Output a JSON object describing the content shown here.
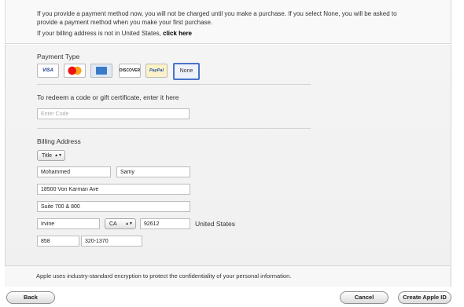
{
  "intro": {
    "line1": "If you provide a payment method now, you will not be charged until you make a purchase. If you select None, you will be asked to",
    "line2": "provide a payment method when you make your first purchase.",
    "line3_prefix": "If your billing address is not in United States, ",
    "line3_link": "click here"
  },
  "payment": {
    "title": "Payment Type",
    "cards": {
      "visa": "VISA",
      "discover": "DISCOVER",
      "paypal": "PayPal"
    },
    "none_label": "None"
  },
  "gift": {
    "title": "To redeem a code or gift certificate, enter it here",
    "placeholder": "Enter Code"
  },
  "billing": {
    "title": "Billing Address",
    "title_select": "Title",
    "first_name": "Mohammed",
    "last_name": "Samy",
    "street1": "18500 Von Karman Ave",
    "street2": "Suite 700 & 800",
    "city": "Irvine",
    "state": "CA",
    "zip": "92612",
    "country": "United States",
    "area_code": "858",
    "phone": "320-1370"
  },
  "footer": {
    "note": "Apple uses industry-standard encryption to protect the confidentiality of your personal information."
  },
  "buttons": {
    "back": "Back",
    "cancel": "Cancel",
    "create": "Create Apple ID"
  },
  "colors": {
    "selected_border": "#4a73c9",
    "panel_bg": "#f2f2f2"
  }
}
